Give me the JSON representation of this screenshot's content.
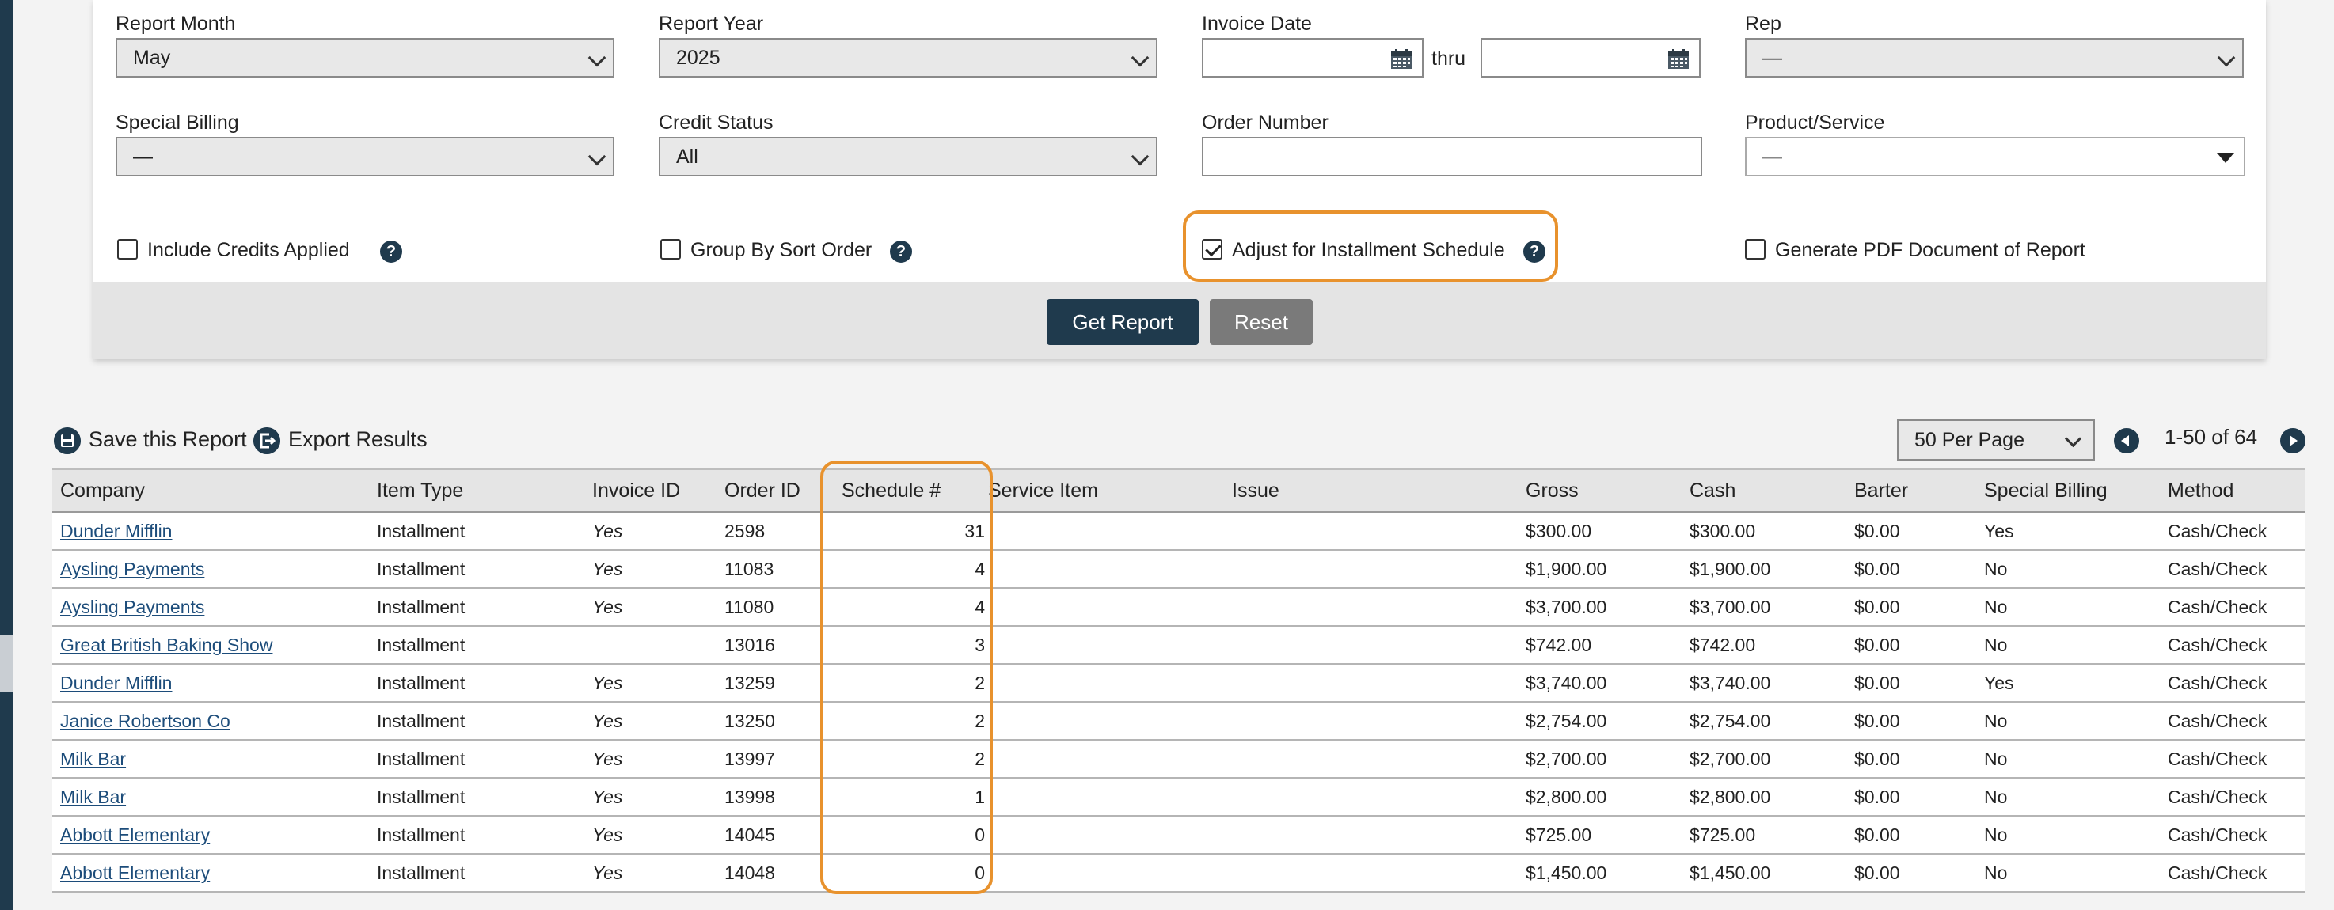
{
  "filters": {
    "report_month": {
      "label": "Report Month",
      "value": "May"
    },
    "report_year": {
      "label": "Report Year",
      "value": "2025"
    },
    "invoice_date": {
      "label": "Invoice Date",
      "thru": "thru",
      "from_value": "",
      "to_value": ""
    },
    "rep": {
      "label": "Rep",
      "value": "—"
    },
    "special_billing": {
      "label": "Special Billing",
      "value": "—"
    },
    "credit_status": {
      "label": "Credit Status",
      "value": "All"
    },
    "order_number": {
      "label": "Order Number",
      "value": ""
    },
    "product_service": {
      "label": "Product/Service",
      "value": "—"
    }
  },
  "options": {
    "include_credits": {
      "label": "Include Credits Applied",
      "checked": false
    },
    "group_by_sort": {
      "label": "Group By Sort Order",
      "checked": false
    },
    "adjust_installment": {
      "label": "Adjust for Installment Schedule",
      "checked": true
    },
    "generate_pdf": {
      "label": "Generate PDF Document of Report",
      "checked": false
    },
    "help_glyph": "?"
  },
  "buttons": {
    "get_report": "Get Report",
    "reset": "Reset"
  },
  "toolbar": {
    "save": "Save this Report",
    "export": "Export Results",
    "per_page": "50 Per Page",
    "page_range": "1-50 of 64"
  },
  "table": {
    "columns": [
      "Company",
      "Item Type",
      "Invoice ID",
      "Order ID",
      "Schedule #",
      "Service Item",
      "Issue",
      "Gross",
      "Cash",
      "Barter",
      "Special Billing",
      "Method"
    ],
    "rows": [
      {
        "company": "Dunder Mifflin",
        "item_type": "Installment",
        "invoice_id": "Yes",
        "order_id": "2598",
        "schedule": "31",
        "service_item": "",
        "issue": "",
        "gross": "$300.00",
        "cash": "$300.00",
        "barter": "$0.00",
        "special_billing": "Yes",
        "method": "Cash/Check"
      },
      {
        "company": "Aysling Payments",
        "item_type": "Installment",
        "invoice_id": "Yes",
        "order_id": "11083",
        "schedule": "4",
        "service_item": "",
        "issue": "",
        "gross": "$1,900.00",
        "cash": "$1,900.00",
        "barter": "$0.00",
        "special_billing": "No",
        "method": "Cash/Check"
      },
      {
        "company": "Aysling Payments",
        "item_type": "Installment",
        "invoice_id": "Yes",
        "order_id": "11080",
        "schedule": "4",
        "service_item": "",
        "issue": "",
        "gross": "$3,700.00",
        "cash": "$3,700.00",
        "barter": "$0.00",
        "special_billing": "No",
        "method": "Cash/Check"
      },
      {
        "company": "Great British Baking Show",
        "item_type": "Installment",
        "invoice_id": "",
        "order_id": "13016",
        "schedule": "3",
        "service_item": "",
        "issue": "",
        "gross": "$742.00",
        "cash": "$742.00",
        "barter": "$0.00",
        "special_billing": "No",
        "method": "Cash/Check"
      },
      {
        "company": "Dunder Mifflin",
        "item_type": "Installment",
        "invoice_id": "Yes",
        "order_id": "13259",
        "schedule": "2",
        "service_item": "",
        "issue": "",
        "gross": "$3,740.00",
        "cash": "$3,740.00",
        "barter": "$0.00",
        "special_billing": "Yes",
        "method": "Cash/Check"
      },
      {
        "company": "Janice Robertson Co",
        "item_type": "Installment",
        "invoice_id": "Yes",
        "order_id": "13250",
        "schedule": "2",
        "service_item": "",
        "issue": "",
        "gross": "$2,754.00",
        "cash": "$2,754.00",
        "barter": "$0.00",
        "special_billing": "No",
        "method": "Cash/Check"
      },
      {
        "company": "Milk Bar",
        "item_type": "Installment",
        "invoice_id": "Yes",
        "order_id": "13997",
        "schedule": "2",
        "service_item": "",
        "issue": "",
        "gross": "$2,700.00",
        "cash": "$2,700.00",
        "barter": "$0.00",
        "special_billing": "No",
        "method": "Cash/Check"
      },
      {
        "company": "Milk Bar",
        "item_type": "Installment",
        "invoice_id": "Yes",
        "order_id": "13998",
        "schedule": "1",
        "service_item": "",
        "issue": "",
        "gross": "$2,800.00",
        "cash": "$2,800.00",
        "barter": "$0.00",
        "special_billing": "No",
        "method": "Cash/Check"
      },
      {
        "company": "Abbott Elementary",
        "item_type": "Installment",
        "invoice_id": "Yes",
        "order_id": "14045",
        "schedule": "0",
        "service_item": "",
        "issue": "",
        "gross": "$725.00",
        "cash": "$725.00",
        "barter": "$0.00",
        "special_billing": "No",
        "method": "Cash/Check"
      },
      {
        "company": "Abbott Elementary",
        "item_type": "Installment",
        "invoice_id": "Yes",
        "order_id": "14048",
        "schedule": "0",
        "service_item": "",
        "issue": "",
        "gross": "$1,450.00",
        "cash": "$1,450.00",
        "barter": "$0.00",
        "special_billing": "No",
        "method": "Cash/Check"
      }
    ]
  },
  "colors": {
    "accent": "#1f3a4d",
    "highlight": "#e8922d",
    "link": "#1c4c7a"
  }
}
